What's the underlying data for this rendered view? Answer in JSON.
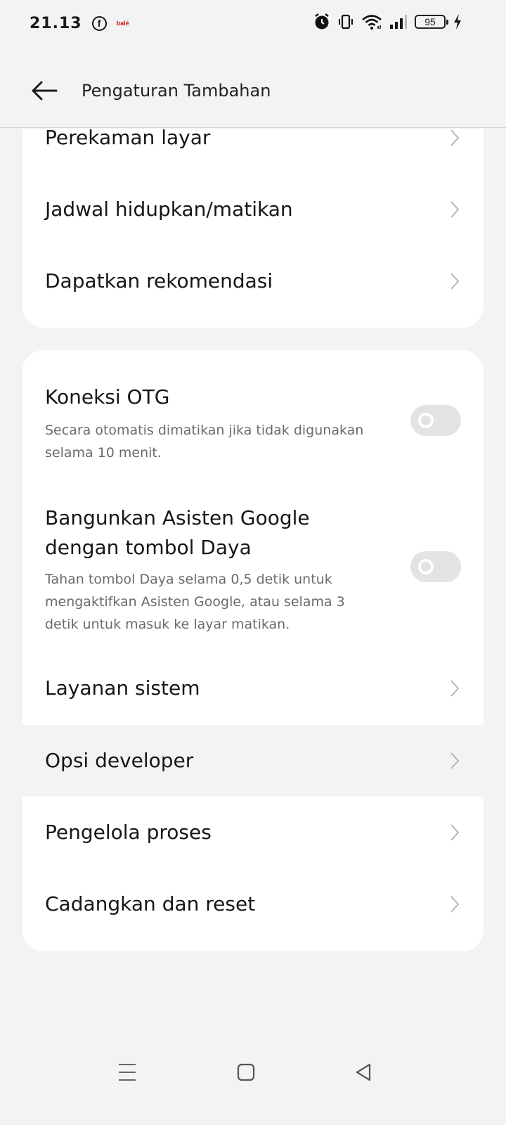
{
  "status_bar": {
    "time": "21.13",
    "fb_glyph": "f",
    "bale_label": "balé",
    "battery_level": "95",
    "icons": [
      "facebook-icon",
      "bale-icon",
      "alarm-icon",
      "vibrate-icon",
      "wifi-icon",
      "signal-icon",
      "battery-icon",
      "charging-icon"
    ]
  },
  "header": {
    "title": "Pengaturan Tambahan",
    "back_icon": "arrow-left-icon"
  },
  "card1": {
    "items": [
      {
        "label": "Perekaman layar"
      },
      {
        "label": "Jadwal hidupkan/matikan"
      },
      {
        "label": "Dapatkan rekomendasi"
      }
    ]
  },
  "card2": {
    "otg": {
      "title": "Koneksi OTG",
      "subtitle": "Secara otomatis dimatikan jika tidak digunakan selama 10 menit.",
      "enabled": false
    },
    "assistant": {
      "title": "Bangunkan Asisten Google dengan tombol Daya",
      "subtitle": "Tahan tombol Daya selama 0,5 detik untuk mengaktifkan Asisten Google, atau selama 3 detik untuk masuk ke layar matikan.",
      "enabled": false
    },
    "items": [
      {
        "label": "Layanan sistem"
      },
      {
        "label": "Opsi developer"
      },
      {
        "label": "Pengelola proses"
      },
      {
        "label": "Cadangkan dan reset"
      }
    ]
  },
  "colors": {
    "background": "#f3f3f3",
    "card": "#ffffff",
    "toggle_off": "#e3e3e3",
    "chevron": "#b5b5b5"
  },
  "nav_bar": {
    "icons": [
      "menu-icon",
      "home-square-icon",
      "back-triangle-icon"
    ]
  }
}
